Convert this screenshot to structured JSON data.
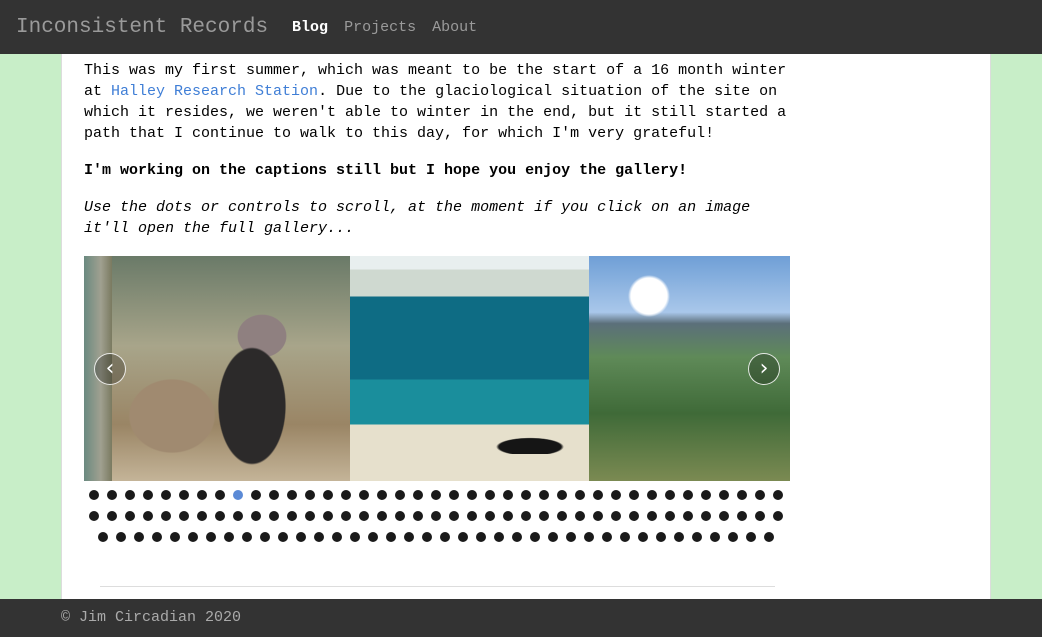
{
  "nav": {
    "brand": "Inconsistent Records",
    "links": [
      {
        "label": "Blog",
        "active": true
      },
      {
        "label": "Projects",
        "active": false
      },
      {
        "label": "About",
        "active": false
      }
    ]
  },
  "post": {
    "p1_before": "This was my first summer, which was meant to be the start of a 16 month winter at ",
    "p1_link": "Halley Research Station",
    "p1_after": ". Due to the glaciological situation of the site on which it resides, we weren't able to winter in the end, but it still started a path that I continue to walk to this day, for which I'm very grateful!",
    "p2": "I'm working on the captions still but I hope you enjoy the gallery!",
    "p3": "Use the dots or controls to scroll, at the moment if you click on an image it'll open the full gallery..."
  },
  "gallery": {
    "prev_icon": "chevron-left-icon",
    "next_icon": "chevron-right-icon",
    "prev_glyph": "‹",
    "next_glyph": "›",
    "dot_count": 116,
    "active_dot": 8,
    "colors": {
      "active_dot": "#5b8ad6",
      "dot": "#1a1a1a"
    }
  },
  "footer": {
    "text": "© Jim Circadian 2020"
  },
  "colors": {
    "page_bg": "#c8eec8",
    "navbar_bg": "#333333",
    "link": "#3f7ed6"
  }
}
